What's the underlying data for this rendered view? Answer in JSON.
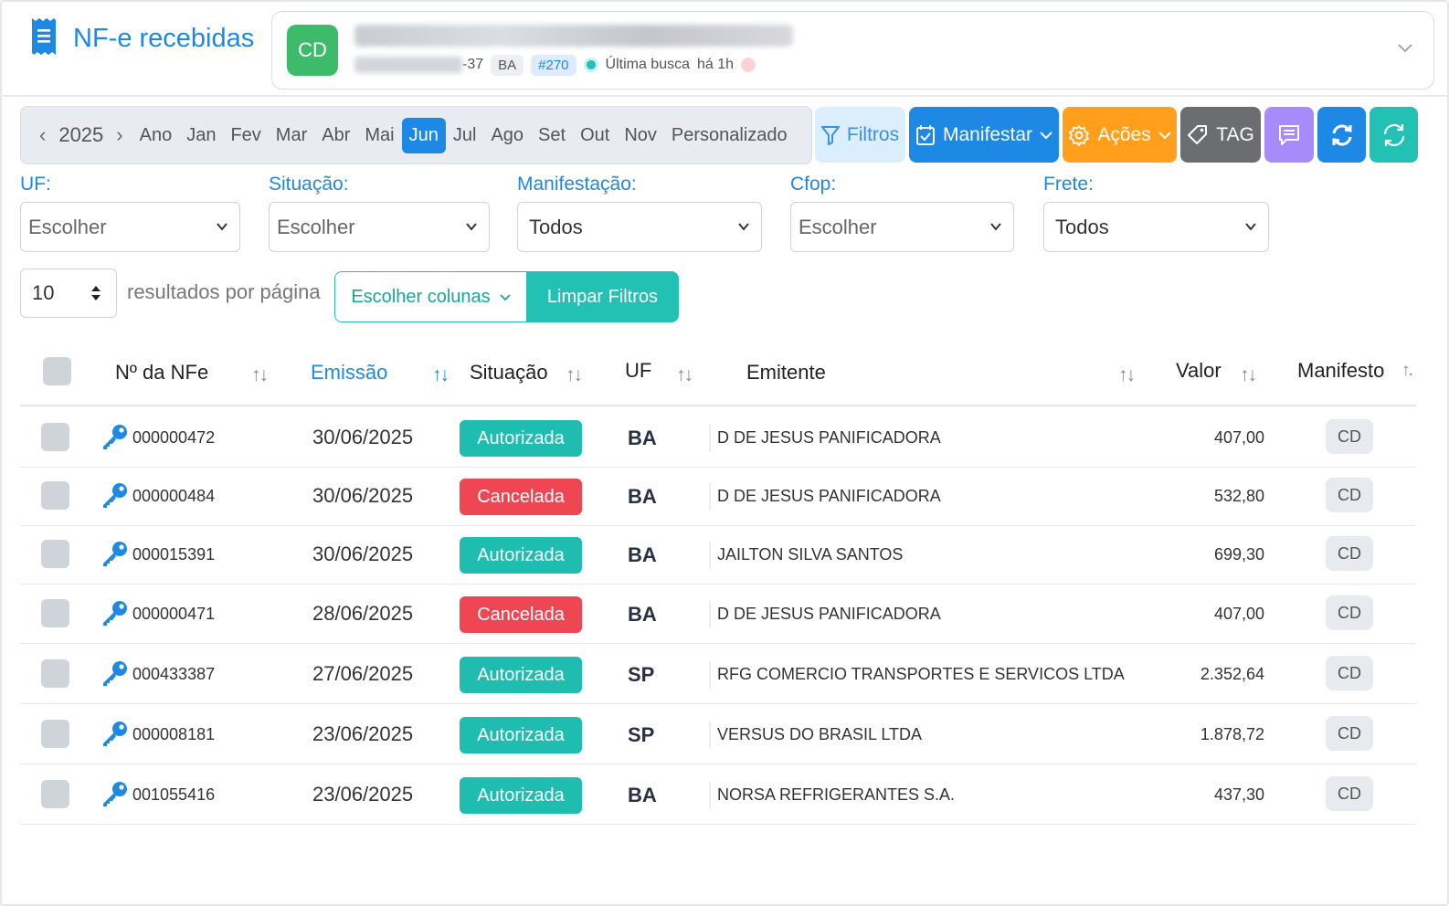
{
  "header": {
    "title": "NF-e recebidas",
    "company": {
      "initials": "CD",
      "cnpj_suffix": "-37",
      "uf": "BA",
      "tag": "#270",
      "last_search_label": "Última busca",
      "last_search_time": "há 1h"
    }
  },
  "period": {
    "year": "2025",
    "prev_label": "‹",
    "next_label": "›",
    "items": [
      "Ano",
      "Jan",
      "Fev",
      "Mar",
      "Abr",
      "Mai",
      "Jun",
      "Jul",
      "Ago",
      "Set",
      "Out",
      "Nov",
      "Personalizado"
    ],
    "active": "Jun"
  },
  "toolbar": {
    "filtros": "Filtros",
    "manifestar": "Manifestar",
    "acoes": "Ações",
    "tag": "TAG"
  },
  "filters": {
    "uf": {
      "label": "UF:",
      "value": "Escolher"
    },
    "situacao": {
      "label": "Situação:",
      "value": "Escolher"
    },
    "manifestacao": {
      "label": "Manifestação:",
      "value": "Todos"
    },
    "cfop": {
      "label": "Cfop:",
      "value": "Escolher"
    },
    "frete": {
      "label": "Frete:",
      "value": "Todos"
    }
  },
  "pagination": {
    "page_size": "10",
    "per_page_label": "resultados por página",
    "choose_columns": "Escolher colunas",
    "clear_filters": "Limpar Filtros"
  },
  "table": {
    "columns": {
      "numero": "Nº da NFe",
      "emissao": "Emissão",
      "situacao": "Situação",
      "uf": "UF",
      "emitente": "Emitente",
      "valor": "Valor",
      "manifesto": "Manifesto"
    },
    "sort_icon": "↑↓",
    "rows": [
      {
        "numero": "000000472",
        "emissao": "30/06/2025",
        "situacao": "Autorizada",
        "uf": "BA",
        "emitente": "D DE JESUS PANIFICADORA",
        "valor": "407,00",
        "manifesto": "CD"
      },
      {
        "numero": "000000484",
        "emissao": "30/06/2025",
        "situacao": "Cancelada",
        "uf": "BA",
        "emitente": "D DE JESUS PANIFICADORA",
        "valor": "532,80",
        "manifesto": "CD"
      },
      {
        "numero": "000015391",
        "emissao": "30/06/2025",
        "situacao": "Autorizada",
        "uf": "BA",
        "emitente": "JAILTON SILVA SANTOS",
        "valor": "699,30",
        "manifesto": "CD"
      },
      {
        "numero": "000000471",
        "emissao": "28/06/2025",
        "situacao": "Cancelada",
        "uf": "BA",
        "emitente": "D DE JESUS PANIFICADORA",
        "valor": "407,00",
        "manifesto": "CD"
      },
      {
        "numero": "000433387",
        "emissao": "27/06/2025",
        "situacao": "Autorizada",
        "uf": "SP",
        "emitente": "RFG COMERCIO TRANSPORTES E SERVICOS LTDA",
        "valor": "2.352,64",
        "manifesto": "CD"
      },
      {
        "numero": "000008181",
        "emissao": "23/06/2025",
        "situacao": "Autorizada",
        "uf": "SP",
        "emitente": "VERSUS DO BRASIL LTDA",
        "valor": "1.878,72",
        "manifesto": "CD"
      },
      {
        "numero": "001055416",
        "emissao": "23/06/2025",
        "situacao": "Autorizada",
        "uf": "BA",
        "emitente": "NORSA REFRIGERANTES S.A.",
        "valor": "437,30",
        "manifesto": "CD"
      }
    ]
  },
  "colors": {
    "primary": "#1e88e5",
    "teal": "#22c1b4",
    "orange": "#ff9f1c",
    "red": "#ef4654",
    "gray": "#6b6d70",
    "purple": "#a78bfa"
  }
}
